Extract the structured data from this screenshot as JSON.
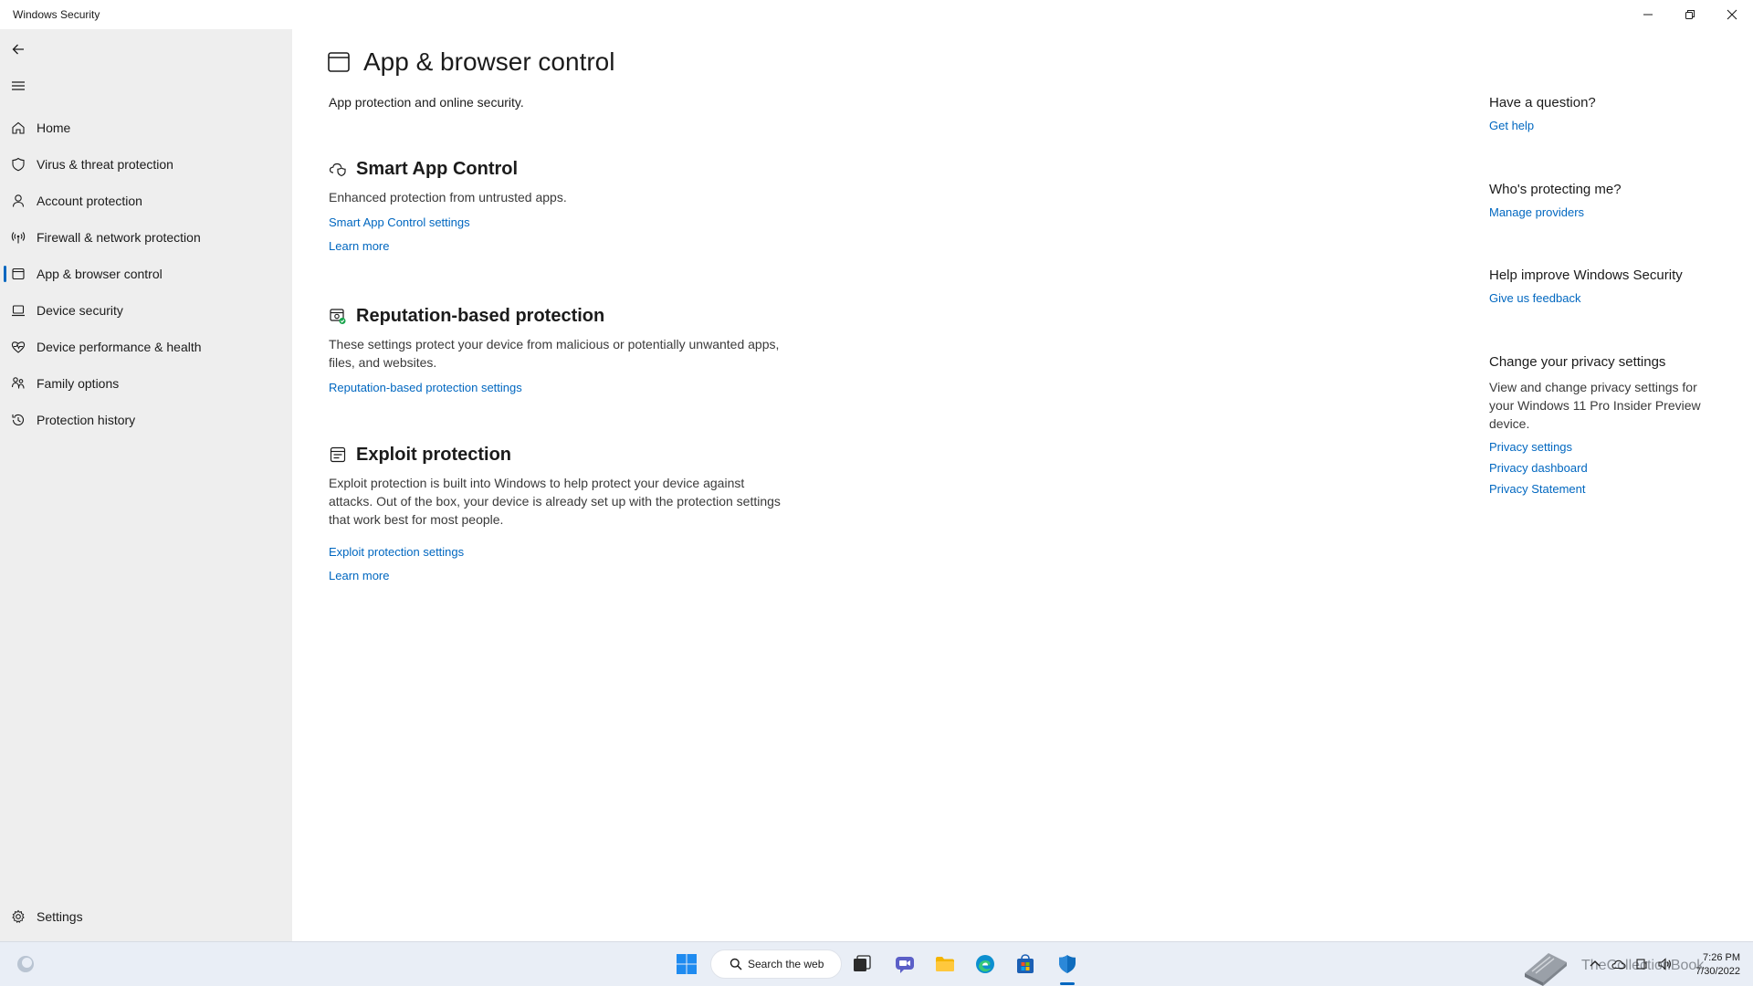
{
  "window": {
    "title": "Windows Security"
  },
  "sidebar": {
    "items": [
      {
        "label": "Home",
        "icon": "home-icon"
      },
      {
        "label": "Virus & threat protection",
        "icon": "shield-icon"
      },
      {
        "label": "Account protection",
        "icon": "person-icon"
      },
      {
        "label": "Firewall & network protection",
        "icon": "antenna-icon"
      },
      {
        "label": "App & browser control",
        "icon": "app-window-icon",
        "active": true
      },
      {
        "label": "Device security",
        "icon": "laptop-icon"
      },
      {
        "label": "Device performance & health",
        "icon": "heart-pulse-icon"
      },
      {
        "label": "Family options",
        "icon": "family-icon"
      },
      {
        "label": "Protection history",
        "icon": "history-icon"
      }
    ],
    "settings_label": "Settings"
  },
  "main": {
    "title": "App & browser control",
    "subtitle": "App protection and online security.",
    "sections": [
      {
        "title": "Smart App Control",
        "icon": "cloud-shield-icon",
        "description": "Enhanced protection from untrusted apps.",
        "links": [
          "Smart App Control settings",
          "Learn more"
        ]
      },
      {
        "title": "Reputation-based protection",
        "icon": "reputation-icon",
        "description": "These settings protect your device from malicious or potentially unwanted apps, files, and websites.",
        "links": [
          "Reputation-based protection settings"
        ]
      },
      {
        "title": "Exploit protection",
        "icon": "exploit-icon",
        "description": "Exploit protection is built into Windows to help protect your device against attacks.  Out of the box, your device is already set up with the protection settings that work best for most people.",
        "links": [
          "Exploit protection settings",
          "Learn more"
        ]
      }
    ]
  },
  "aside": {
    "question": {
      "heading": "Have a question?",
      "link": "Get help"
    },
    "protecting": {
      "heading": "Who's protecting me?",
      "link": "Manage providers"
    },
    "improve": {
      "heading": "Help improve Windows Security",
      "link": "Give us feedback"
    },
    "privacy": {
      "heading": "Change your privacy settings",
      "description": "View and change privacy settings for your Windows 11 Pro Insider Preview device.",
      "links": [
        "Privacy settings",
        "Privacy dashboard",
        "Privacy Statement"
      ]
    }
  },
  "taskbar": {
    "search_label": "Search the web",
    "time": "7:26 PM",
    "date": "7/30/2022",
    "watermark": "TheCollectionBook"
  },
  "colors": {
    "accent": "#0067c0",
    "sidebar_bg": "#eeeeee",
    "taskbar_bg": "#e9eef6"
  }
}
